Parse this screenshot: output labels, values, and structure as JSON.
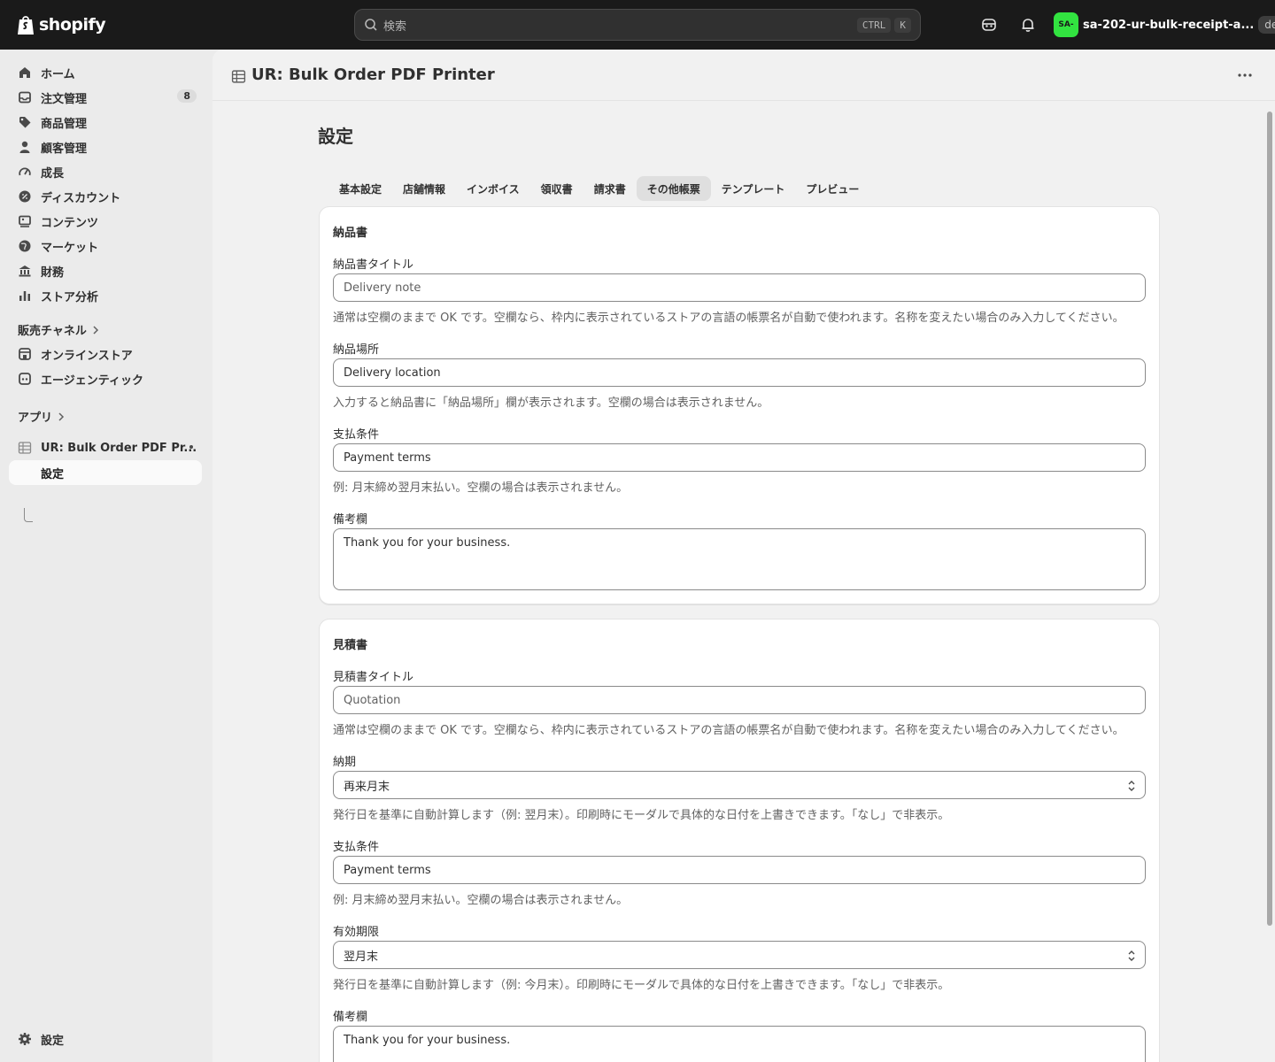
{
  "topbar": {
    "logo_text": "shopify",
    "search_placeholder": "検索",
    "shortcut_keys": [
      "CTRL",
      "K"
    ],
    "store_avatar": "SA-",
    "store_name": "sa-202-ur-bulk-receipt-a...",
    "store_badge": "dev"
  },
  "sidebar": {
    "items": [
      {
        "label": "ホーム",
        "icon": "home-icon"
      },
      {
        "label": "注文管理",
        "icon": "inbox-icon",
        "badge": "8"
      },
      {
        "label": "商品管理",
        "icon": "tag-icon"
      },
      {
        "label": "顧客管理",
        "icon": "person-icon"
      },
      {
        "label": "成長",
        "icon": "gauge-icon"
      },
      {
        "label": "ディスカウント",
        "icon": "discount-icon"
      },
      {
        "label": "コンテンツ",
        "icon": "content-icon"
      },
      {
        "label": "マーケット",
        "icon": "globe-icon"
      },
      {
        "label": "財務",
        "icon": "bank-icon"
      },
      {
        "label": "ストア分析",
        "icon": "chart-bar-icon"
      }
    ],
    "sales_channels_label": "販売チャネル",
    "channels": [
      {
        "label": "オンラインストア",
        "icon": "store-icon"
      },
      {
        "label": "エージェンティック",
        "icon": "agent-icon"
      }
    ],
    "apps_label": "アプリ",
    "app_name": "UR: Bulk Order PDF Pr...",
    "app_sub_item": "設定",
    "settings_label": "設定"
  },
  "app": {
    "title": "UR: Bulk Order PDF Printer",
    "page_title": "設定",
    "tabs": [
      "基本設定",
      "店舗情報",
      "インボイス",
      "領収書",
      "請求書",
      "その他帳票",
      "テンプレート",
      "プレビュー"
    ],
    "selected_tab": "その他帳票"
  },
  "delivery_card": {
    "title": "納品書",
    "title_label": "納品書タイトル",
    "title_placeholder": "Delivery note",
    "title_help": "通常は空欄のままで OK です。空欄なら、枠内に表示されているストアの言語の帳票名が自動で使われます。名称を変えたい場合のみ入力してください。",
    "location_label": "納品場所",
    "location_value": "Delivery location",
    "location_help": "入力すると納品書に「納品場所」欄が表示されます。空欄の場合は表示されません。",
    "payment_label": "支払条件",
    "payment_value": "Payment terms",
    "payment_help": "例: 月末締め翌月末払い。空欄の場合は表示されません。",
    "remarks_label": "備考欄",
    "remarks_value": "Thank you for your business."
  },
  "quote_card": {
    "title": "見積書",
    "title_label": "見積書タイトル",
    "title_placeholder": "Quotation",
    "title_help": "通常は空欄のままで OK です。空欄なら、枠内に表示されているストアの言語の帳票名が自動で使われます。名称を変えたい場合のみ入力してください。",
    "delivery_label": "納期",
    "delivery_value": "再来月末",
    "delivery_help": "発行日を基準に自動計算します（例: 翌月末）。印刷時にモーダルで具体的な日付を上書きできます。「なし」で非表示。",
    "payment_label": "支払条件",
    "payment_value": "Payment terms",
    "payment_help": "例: 月末締め翌月末払い。空欄の場合は表示されません。",
    "validity_label": "有効期限",
    "validity_value": "翌月末",
    "validity_help": "発行日を基準に自動計算します（例: 今月末）。印刷時にモーダルで具体的な日付を上書きできます。「なし」で非表示。",
    "remarks_label": "備考欄",
    "remarks_value": "Thank you for your business."
  }
}
